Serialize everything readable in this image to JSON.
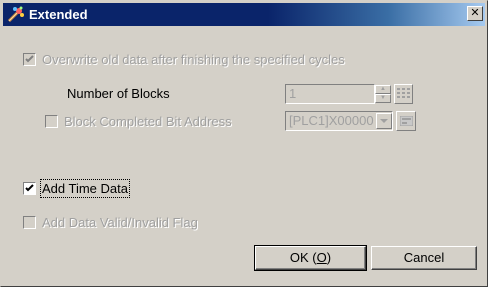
{
  "window": {
    "title": "Extended",
    "close_glyph": "✕"
  },
  "options": {
    "overwrite_label": "Overwrite old data after finishing the specified cycles",
    "overwrite_checked": true,
    "number_of_blocks_label": "Number of Blocks",
    "number_of_blocks_value": "1",
    "block_completed_label": "Block Completed Bit Address",
    "block_completed_checked": false,
    "block_completed_value": "[PLC1]X00000",
    "add_time_data_label": "Add Time Data",
    "add_time_data_checked": true,
    "add_valid_flag_label": "Add Data Valid/Invalid Flag",
    "add_valid_flag_checked": false
  },
  "buttons": {
    "ok_prefix": "OK (",
    "ok_mnemonic": "O",
    "ok_suffix": ")",
    "cancel_label": "Cancel"
  },
  "icons": {
    "title": "extended-settings-icon",
    "keypad": "keypad-icon",
    "address_input": "address-input-icon"
  }
}
